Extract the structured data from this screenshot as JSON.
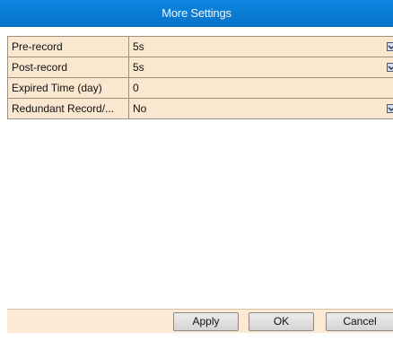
{
  "dialog": {
    "title": "More Settings"
  },
  "settings": [
    {
      "label": "Pre-record",
      "value": "5s",
      "has_dropdown": true
    },
    {
      "label": "Post-record",
      "value": "5s",
      "has_dropdown": true
    },
    {
      "label": "Expired Time (day)",
      "value": "0",
      "has_dropdown": false
    },
    {
      "label": "Redundant Record/...",
      "value": "No",
      "has_dropdown": true
    }
  ],
  "buttons": {
    "apply_label": "Apply",
    "ok_label": "OK",
    "cancel_label": "Cancel"
  },
  "icons": {
    "dropdown": "chevron-down-icon"
  },
  "colors": {
    "titlebar": "#0872c7",
    "title_text": "#f3f7fb",
    "row_bg": "#f9e7cf",
    "footer_bg": "#fbe9d3"
  }
}
